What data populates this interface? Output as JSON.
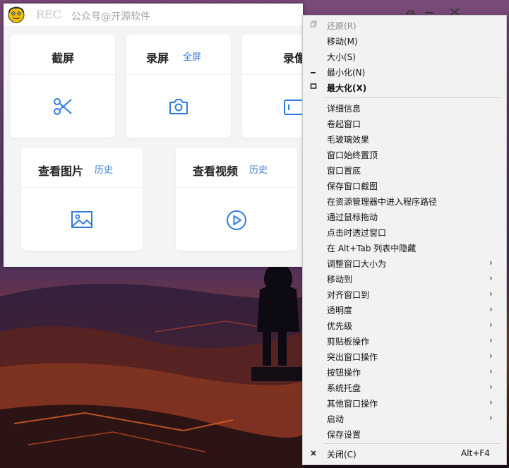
{
  "app": {
    "name": "REC",
    "account": "公众号@开源软件"
  },
  "cards": {
    "screenshot": {
      "title": "截屏"
    },
    "record": {
      "title": "录屏",
      "link": "全屏"
    },
    "record_camera": {
      "title": "录像"
    },
    "view_images": {
      "title": "查看图片",
      "link": "历史"
    },
    "view_videos": {
      "title": "查看视频",
      "link": "历史"
    }
  },
  "context_menu": {
    "items": [
      {
        "label": "还原(R)"
      },
      {
        "label": "移动(M)"
      },
      {
        "label": "大小(S)"
      },
      {
        "label": "最小化(N)"
      },
      {
        "label": "最大化(X)"
      },
      {
        "label": "详细信息"
      },
      {
        "label": "卷起窗口"
      },
      {
        "label": "毛玻璃效果"
      },
      {
        "label": "窗口始终置顶"
      },
      {
        "label": "窗口置底"
      },
      {
        "label": "保存窗口截图"
      },
      {
        "label": "在资源管理器中进入程序路径"
      },
      {
        "label": "通过鼠标拖动"
      },
      {
        "label": "点击时透过窗口"
      },
      {
        "label": "在 Alt+Tab 列表中隐藏"
      },
      {
        "label": "调整窗口大小为"
      },
      {
        "label": "移动到"
      },
      {
        "label": "对齐窗口到"
      },
      {
        "label": "透明度"
      },
      {
        "label": "优先级"
      },
      {
        "label": "剪贴板操作"
      },
      {
        "label": "突出窗口操作"
      },
      {
        "label": "按钮操作"
      },
      {
        "label": "系统托盘"
      },
      {
        "label": "其他窗口操作"
      },
      {
        "label": "启动"
      },
      {
        "label": "保存设置"
      },
      {
        "label": "关闭(C)",
        "shortcut": "Alt+F4"
      }
    ]
  },
  "icons": {
    "restore": "restore-icon",
    "minimize": "minimize-glyph-icon",
    "maximize": "maximize-glyph-icon",
    "close": "close-glyph-icon",
    "submenu": "chevron-right-icon"
  },
  "colors": {
    "accent": "#3a7bd5",
    "menu_bg": "#f2f2f2"
  }
}
